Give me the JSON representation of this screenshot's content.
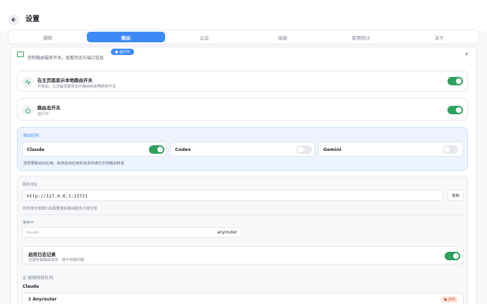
{
  "header": {
    "title": "设置"
  },
  "tabs": [
    {
      "label": "通用"
    },
    {
      "label": "路由",
      "active": true
    },
    {
      "label": "认证"
    },
    {
      "label": "高级"
    },
    {
      "label": "使用统计"
    },
    {
      "label": "关于"
    }
  ],
  "route_section": {
    "description": "控制路由服务开关，查看状态与端口信息",
    "status_pill": "● 运行中"
  },
  "show_local_switch": {
    "title": "在主页面显示本地路由开关",
    "subtitle": "开启后，主页面顶部将显示路由和故障转移开关",
    "enabled": true
  },
  "master_switch": {
    "title": "路由总开关",
    "subtitle": "运行中",
    "enabled": true
  },
  "app_routing": {
    "label": "路由应用",
    "apps": [
      {
        "name": "Claude",
        "enabled": true
      },
      {
        "name": "Codex",
        "enabled": false
      },
      {
        "name": "Gemini",
        "enabled": false
      }
    ],
    "hint": "选择要路由的应用，启用后该应用的请求将通过本地路由转发"
  },
  "server": {
    "address_label": "服务地址",
    "address_value": "http://127.0.0.1:15721",
    "copy_label": "复制",
    "address_hint": "修改地址或端口后需要重启路由服务才能生效",
    "in_use_label": "使用中",
    "provider_placeholder": "claude",
    "provider_value": "anyrouter",
    "log": {
      "title": "启用日志记录",
      "subtitle": "记录所有路由请求，便于排查问题",
      "enabled": true
    },
    "failover_label": "故障转移队列",
    "queue_title": "Claude",
    "queue_item_name": "1  Anyrouter",
    "queue_item_badge": "● 启用"
  },
  "colors": {
    "accent": "#3d8af7",
    "toggle_on": "#2ea15f",
    "toggle_off": "#e6e8ec"
  }
}
